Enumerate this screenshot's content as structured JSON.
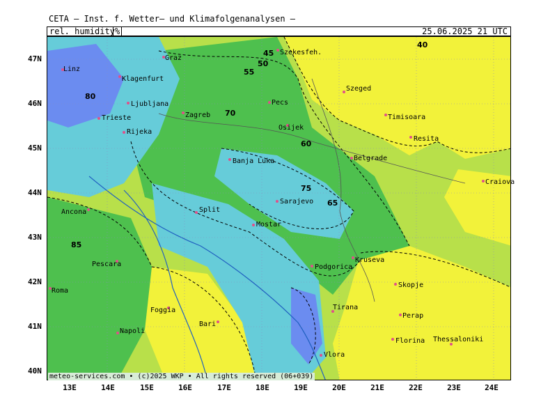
{
  "header": {
    "title": "CETA — Inst. f. Wetter— und Klimafolgenanalysen —"
  },
  "topbar": {
    "variable": "rel. humidity",
    "unit": "%",
    "datetime": "25.06.2025 21 UTC"
  },
  "footer": {
    "credit": "meteo-services.com • (c)2025 WKP • All rights reserved (06+039)"
  },
  "colors": {
    "blue": "#6b8cf0",
    "teal": "#66ccd9",
    "green": "#4ec04e",
    "lime": "#b8e04a",
    "yellow": "#f2f23a"
  },
  "axes": {
    "lat_labels": [
      "47N",
      "46N",
      "45N",
      "44N",
      "43N",
      "42N",
      "41N",
      "40N"
    ],
    "lon_labels": [
      "13E",
      "14E",
      "15E",
      "16E",
      "17E",
      "18E",
      "19E",
      "20E",
      "21E",
      "22E",
      "23E",
      "24E"
    ]
  },
  "cities": [
    "Linz",
    "Graz",
    "Szekesfeh.",
    "Klagenfurt",
    "Szeged",
    "Ljubljana",
    "Pecs",
    "Zagreb",
    "Timisoara",
    "Trieste",
    "Osijek",
    "Rijeka",
    "Resita",
    "Banja Luka",
    "Belgrade",
    "Craiova",
    "Sarajevo",
    "Split",
    "Ancona",
    "Mostar",
    "Pescara",
    "Kruseva",
    "Podgorica",
    "Roma",
    "Skopje",
    "Foggia",
    "Tirana",
    "Perap",
    "Bari",
    "Napoli",
    "Florina",
    "Thessaloniki",
    "Vlora"
  ],
  "contour_labels": [
    "40",
    "45",
    "50",
    "55",
    "60",
    "65",
    "70",
    "75",
    "80",
    "85"
  ]
}
